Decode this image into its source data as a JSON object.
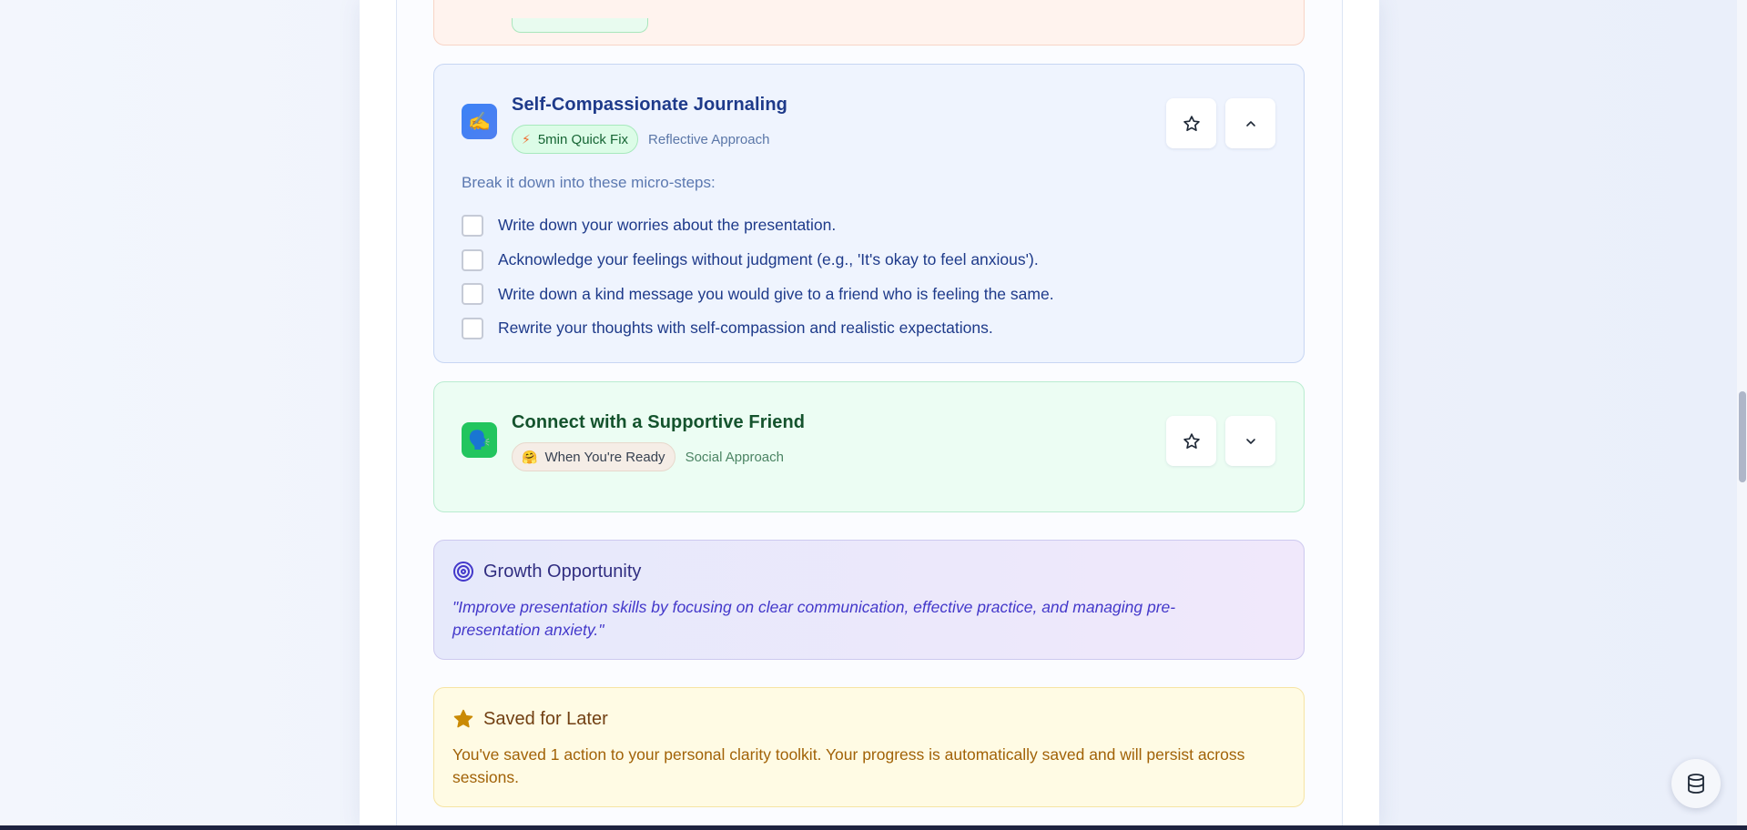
{
  "actions": [
    {
      "title": "Self-Compassionate Journaling",
      "icon": "writing-hand-icon",
      "icon_glyph": "✍️",
      "badge": {
        "icon": "lightning-bolt-icon",
        "icon_glyph": "⚡",
        "label": "5min Quick Fix"
      },
      "approach": "Reflective Approach",
      "expanded": true,
      "micro_steps_intro": "Break it down into these micro-steps:",
      "micro_steps": [
        "Write down your worries about the presentation.",
        "Acknowledge your feelings without judgment (e.g., 'It's okay to feel anxious').",
        "Write down a kind message you would give to a friend who is feeling the same.",
        "Rewrite your thoughts with self-compassion and realistic expectations."
      ]
    },
    {
      "title": "Connect with a Supportive Friend",
      "icon": "speaking-head-icon",
      "icon_glyph": "🗣️",
      "badge": {
        "icon": "hugging-face-icon",
        "icon_glyph": "🤗",
        "label": "When You're Ready"
      },
      "approach": "Social Approach",
      "expanded": false
    }
  ],
  "growth": {
    "title": "Growth Opportunity",
    "quote": "\"Improve presentation skills by focusing on clear communication, effective practice, and managing pre-presentation anxiety.\""
  },
  "saved": {
    "title": "Saved for Later",
    "text": "You've saved 1 action to your personal clarity toolkit. Your progress is automatically saved and will persist across sessions."
  },
  "colors": {
    "journal_accent": "#1e3a8a",
    "friend_accent": "#14532d",
    "growth_accent": "#4338ca",
    "saved_accent": "#a16207",
    "star_fill": "#ca8a04"
  }
}
